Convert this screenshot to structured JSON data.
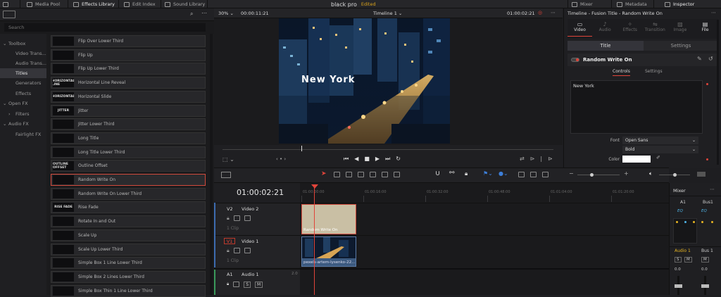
{
  "topbar": {
    "media_pool": "Media Pool",
    "effects_library": "Effects Library",
    "edit_index": "Edit Index",
    "sound_library": "Sound Library",
    "project_name": "black pro",
    "status": "Edited",
    "mixer": "Mixer",
    "metadata": "Metadata",
    "inspector": "Inspector"
  },
  "search": {
    "placeholder": "Search"
  },
  "tree": [
    {
      "label": "Toolbox",
      "arrow": "⌄"
    },
    {
      "label": "Video Trans..."
    },
    {
      "label": "Audio Trans..."
    },
    {
      "label": "Titles"
    },
    {
      "label": "Generators"
    },
    {
      "label": "Effects"
    },
    {
      "label": "Open FX",
      "arrow": "⌄"
    },
    {
      "label": "Filters",
      "arrow": "›"
    },
    {
      "label": "Audio FX",
      "arrow": "⌄"
    },
    {
      "label": "Fairlight FX"
    }
  ],
  "titles": [
    "Flip Over Lower Third",
    "Flip Up",
    "Flip Up Lower Third",
    "Horizontal Line Reveal",
    "Horizontal Slide",
    "Jitter",
    "Jitter Lower Third",
    "Long Title",
    "Long Title Lower Third",
    "Outline Offset",
    "Random Write On",
    "Random Write On Lower Third",
    "Rise Fade",
    "Rotate In and Out",
    "Scale Up",
    "Scale Up Lower Third",
    "Simple Box 1 Line Lower Third",
    "Simple Box 2 Lines Lower Third",
    "Simple Box Thin 1 Line Lower Third"
  ],
  "thumb_texts": [
    "",
    "",
    "",
    "HORIZONTAL LINE",
    "HORIZONTAL",
    "JITTER",
    "",
    "",
    "",
    "OUTLINE OFFSET",
    "",
    "",
    "RISE FADE",
    "",
    "",
    "",
    "",
    "",
    ""
  ],
  "viewer": {
    "zoom": "30%",
    "source_tc": "00:00:11:21",
    "timeline_name": "Timeline 1",
    "record_tc": "01:00:02:21",
    "overlay_title": "New York"
  },
  "inspector": {
    "header": "Timeline - Fusion Title - Random Write On",
    "tabs": [
      "Video",
      "Audio",
      "Effects",
      "Transition",
      "Image",
      "File"
    ],
    "subtabs": [
      "Title",
      "Settings"
    ],
    "effect_name": "Random Write On",
    "controls_tabs": [
      "Controls",
      "Settings"
    ],
    "text_value": "New York",
    "font_label": "Font",
    "font_value": "Open Sans",
    "style_value": "Bold",
    "color_label": "Color"
  },
  "timeline": {
    "timecode": "01:00:02:21",
    "ruler": [
      "01:00:00:00",
      "01:00:16:00",
      "01:00:32:00",
      "01:00:48:00",
      "01:01:04:00",
      "01:01:20:00"
    ],
    "tracks": [
      {
        "id": "V2",
        "name": "Video 2",
        "clips": "1 Clip"
      },
      {
        "id": "V1",
        "name": "Video 1",
        "clips": "1 Clip"
      },
      {
        "id": "A1",
        "name": "Audio 1",
        "level": "2.0"
      }
    ],
    "title_clip": "Random Write On",
    "video_clip": "pexels-artem-lysenko-22..."
  },
  "mixer": {
    "title": "Mixer",
    "channels": [
      "A1",
      "Bus1"
    ],
    "eq": "EQ",
    "strip_label": "Audio 1",
    "strip_bus": "Bus 1",
    "s_btn": "S",
    "m_btn": "M",
    "level": "0.0"
  },
  "colors": {
    "accent_red": "#e0443a",
    "edited": "#d9a21b",
    "title_clip": "#c9bfa4",
    "video_clip": "#3c5a80"
  }
}
